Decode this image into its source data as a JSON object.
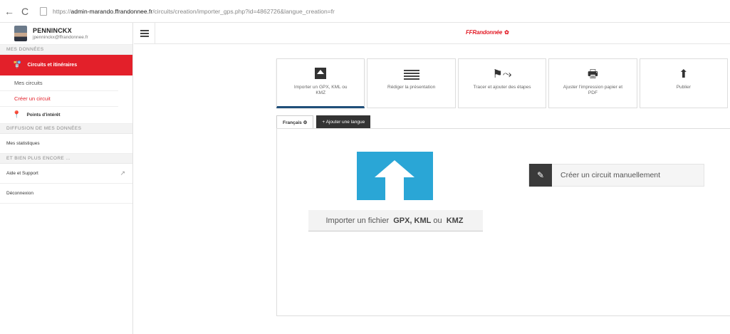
{
  "browser": {
    "back_icon": "←",
    "reload_icon": "C",
    "url_prefix": "https://",
    "url_host": "admin-marando.ffrandonnee.fr",
    "url_path": "/circuits/creation/importer_gps.php?id=4862726&langue_creation=fr"
  },
  "sidebar": {
    "user_name": "PENNINCKX",
    "user_email": "jpenninckx@ffrandonnee.fr",
    "section_mes_donnees": "MES DONNÉES",
    "active_item": "Circuits et itinéraires",
    "sub_items": [
      "Mes circuits",
      "Créer un circuit"
    ],
    "points_interet": "Points d'intérêt",
    "section_diffusion": "DIFFUSION DE MES DONNÉES",
    "mes_statistiques": "Mes statistiques",
    "section_plus": "ET BIEN PLUS ENCORE ...",
    "aide_support": "Aide et Support",
    "deconnexion": "Déconnexion"
  },
  "header": {
    "logo_text": "FFRandonnée"
  },
  "steps": [
    {
      "label": "Importer un GPX, KML ou KMZ",
      "icon": "upload-box-icon"
    },
    {
      "label": "Rédiger la présentation",
      "icon": "text-lines-icon"
    },
    {
      "label": "Tracer et ajouter des étapes",
      "icon": "trace-icon"
    },
    {
      "label": "Ajuster l'impression papier et PDF",
      "icon": "printer-icon"
    },
    {
      "label": "Publier",
      "icon": "upload-arrow-icon"
    }
  ],
  "lang_tabs": {
    "current": "Français",
    "add": "+ Ajouter une langue"
  },
  "content": {
    "import_prefix": "Importer un fichier",
    "import_formats": "GPX, KML",
    "import_ou": "ou",
    "import_kmz": "KMZ",
    "manual_label": "Créer un circuit manuellement"
  },
  "colors": {
    "accent_red": "#e3202a",
    "tile_blue": "#2aa6d6",
    "active_step_border": "#1f4e79"
  }
}
